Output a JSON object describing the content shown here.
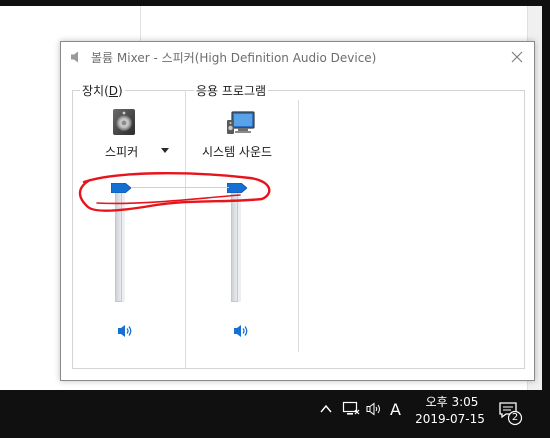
{
  "window": {
    "title": "볼륨 Mixer - 스피커(High Definition Audio Device)"
  },
  "device_section": {
    "label": "장치(D)",
    "label_prefix": "장치(",
    "label_accel": "D",
    "label_suffix": ")",
    "device_name": "스피커",
    "volume_level_percent": 100,
    "mute_icon": "speaker-icon"
  },
  "app_section": {
    "label": "응용 프로그램",
    "apps": [
      {
        "name": "시스템 사운드",
        "volume_level_percent": 100,
        "icon": "system-sounds-icon",
        "mute_icon": "speaker-icon"
      }
    ]
  },
  "taskbar": {
    "time": "오후 3:05",
    "date": "2019-07-15",
    "ime_indicator": "A",
    "notification_count": "2",
    "tray_icons": [
      "chevron-up-icon",
      "network-icon",
      "volume-icon"
    ]
  },
  "colors": {
    "accent": "#1570d4",
    "annotation": "#e8141c",
    "taskbar": "#101010"
  }
}
